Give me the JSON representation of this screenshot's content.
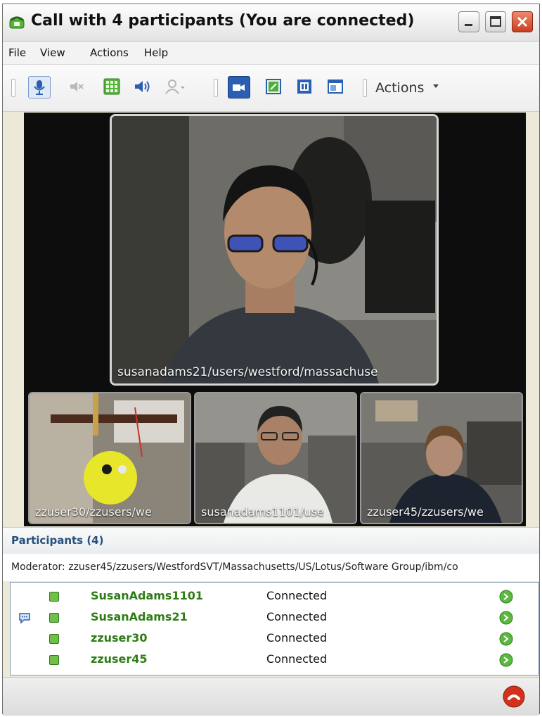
{
  "window": {
    "title": "Call with 4 participants (You are connected)"
  },
  "menu": [
    {
      "label": "File"
    },
    {
      "label": "View"
    },
    {
      "label": "Actions"
    },
    {
      "label": "Help"
    }
  ],
  "toolbar": {
    "actions_label": "Actions",
    "icons": [
      "microphone-icon",
      "speaker-unmute-icon",
      "keypad-icon",
      "speaker-icon",
      "participant-add-icon",
      "video-camera-icon",
      "video-preview-icon",
      "pause-video-icon",
      "layout-icon"
    ]
  },
  "videos": {
    "main": {
      "label": "susanadams21/users/westford/massachuse"
    },
    "thumbnails": [
      {
        "label": "zzuser30/zzusers/we"
      },
      {
        "label": "susanadams1101/use"
      },
      {
        "label": "zzuser45/zzusers/we"
      }
    ]
  },
  "participants_panel": {
    "header": "Participants (4)",
    "moderator": "Moderator: zzuser45/zzusers/WestfordSVT/Massachusetts/US/Lotus/Software Group/ibm/co",
    "rows": [
      {
        "name": "SusanAdams1101",
        "status": "Connected",
        "chat": false
      },
      {
        "name": "SusanAdams21",
        "status": "Connected",
        "chat": true
      },
      {
        "name": "zzuser30",
        "status": "Connected",
        "chat": false
      },
      {
        "name": "zzuser45",
        "status": "Connected",
        "chat": false
      }
    ]
  },
  "colors": {
    "participant_name": "#2e7d14",
    "header_text": "#24507a",
    "hangup": "#d2321c",
    "toolbar_active": "#2a5fb4"
  }
}
